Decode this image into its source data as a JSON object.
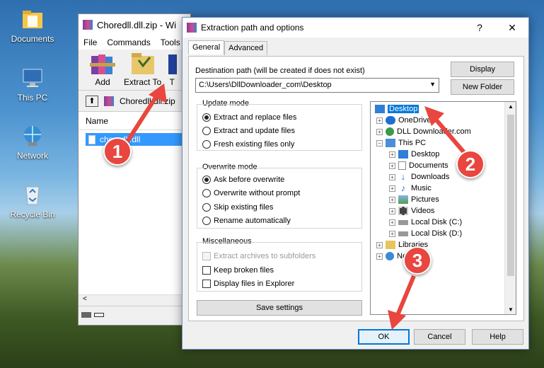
{
  "desktop": {
    "icons": [
      {
        "label": "Documents"
      },
      {
        "label": "This PC"
      },
      {
        "label": "Network"
      },
      {
        "label": "Recycle Bin"
      }
    ]
  },
  "winrar": {
    "title": "Choredll.dll.zip - Wi",
    "menu": [
      "File",
      "Commands",
      "Tools"
    ],
    "toolbar": [
      "Add",
      "Extract To",
      "T"
    ],
    "address": "Choredll.dll.zip",
    "column_name": "Name",
    "file_item": "choredll.dll",
    "scroll_left": "<"
  },
  "dialog": {
    "title": "Extraction path and options",
    "help": "?",
    "close": "✕",
    "tabs": [
      "General",
      "Advanced"
    ],
    "dest_label": "Destination path (will be created if does not exist)",
    "dest_value": "C:\\Users\\DllDownloader_com\\Desktop",
    "display_button": "Display",
    "new_folder_button": "New Folder",
    "update_mode": {
      "title": "Update mode",
      "options": [
        "Extract and replace files",
        "Extract and update files",
        "Fresh existing files only"
      ],
      "selected": 0
    },
    "overwrite_mode": {
      "title": "Overwrite mode",
      "options": [
        "Ask before overwrite",
        "Overwrite without prompt",
        "Skip existing files",
        "Rename automatically"
      ],
      "selected": 0
    },
    "misc": {
      "title": "Miscellaneous",
      "options": [
        "Extract archives to subfolders",
        "Keep broken files",
        "Display files in Explorer"
      ]
    },
    "save_settings": "Save settings",
    "tree": [
      "Desktop",
      "OneDrive",
      "DLL Downloader.com",
      "This PC",
      "Desktop",
      "Documents",
      "Downloads",
      "Music",
      "Pictures",
      "Videos",
      "Local Disk (C:)",
      "Local Disk (D:)",
      "Libraries",
      "Network"
    ],
    "ok": "OK",
    "cancel": "Cancel",
    "help_button": "Help"
  },
  "markers": [
    "1",
    "2",
    "3"
  ],
  "colors": {
    "marker": "#e8463e",
    "selection": "#0078d7",
    "list_selection": "#3399ff"
  }
}
